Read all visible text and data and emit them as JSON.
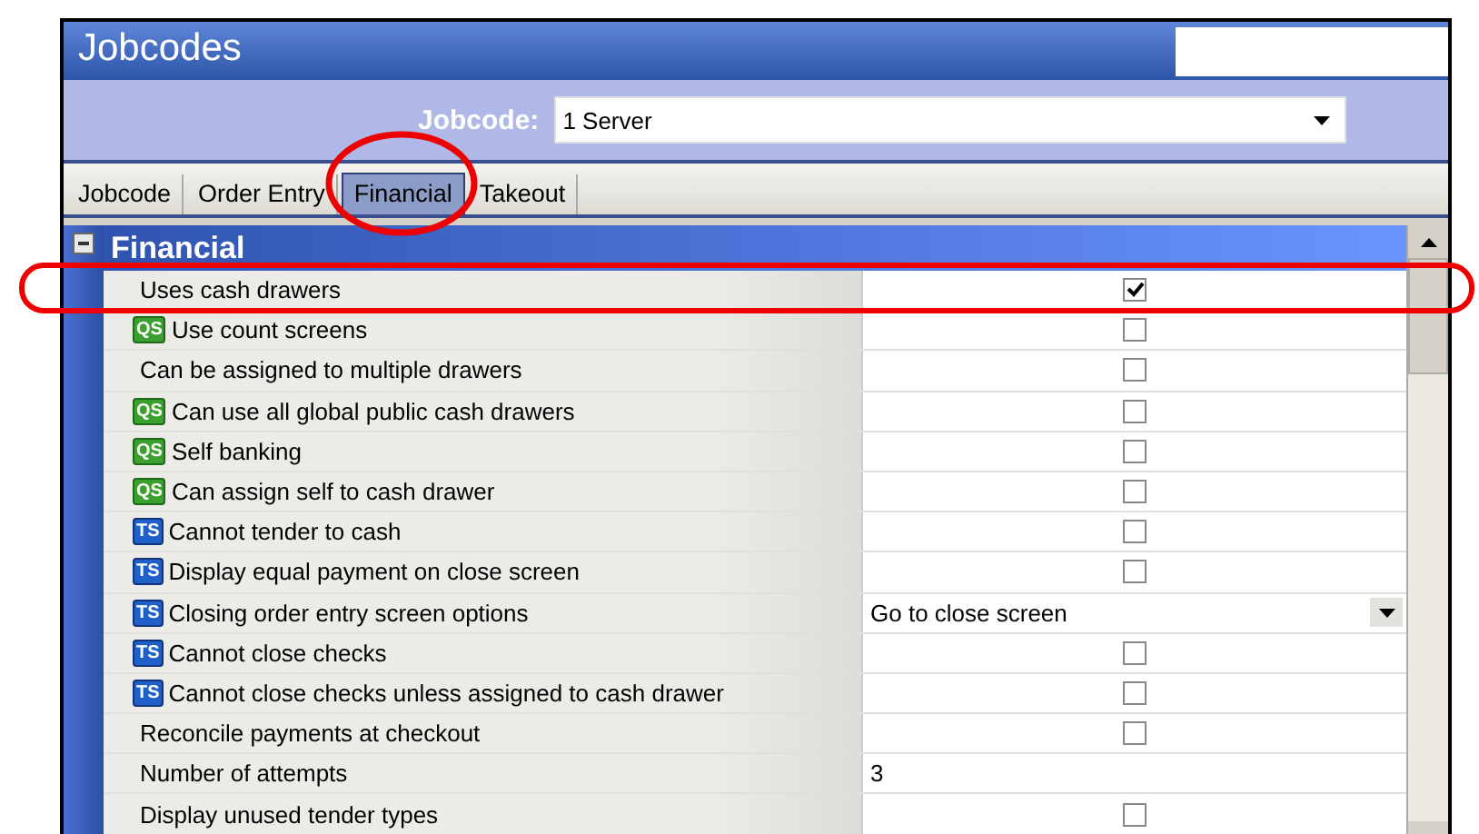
{
  "window": {
    "title": "Jobcodes"
  },
  "jobcode": {
    "label": "Jobcode:",
    "value": "1 Server"
  },
  "tabs": [
    {
      "label": "Jobcode",
      "selected": false
    },
    {
      "label": "Order Entry",
      "selected": false
    },
    {
      "label": "Financial",
      "selected": true
    },
    {
      "label": "Takeout",
      "selected": false
    }
  ],
  "section": {
    "title": "Financial",
    "expanded": true
  },
  "rows": [
    {
      "label": "Uses cash drawers",
      "kind": "checkbox",
      "checked": true
    },
    {
      "label": "Use count screens",
      "badge": "QS",
      "kind": "checkbox",
      "checked": false
    },
    {
      "label": "Can be assigned to multiple drawers",
      "kind": "checkbox",
      "checked": false
    },
    {
      "label": "Can use all global public cash drawers",
      "badge": "QS",
      "kind": "checkbox",
      "checked": false
    },
    {
      "label": "Self banking",
      "badge": "QS",
      "kind": "checkbox",
      "checked": false
    },
    {
      "label": "Can assign self to cash drawer",
      "badge": "QS",
      "kind": "checkbox",
      "checked": false
    },
    {
      "label": "Cannot tender to cash",
      "badge": "TS",
      "kind": "checkbox",
      "checked": false
    },
    {
      "label": "Display equal payment on close screen",
      "badge": "TS",
      "kind": "checkbox",
      "checked": false
    },
    {
      "label": "Closing order entry screen options",
      "badge": "TS",
      "kind": "select",
      "value": "Go to close screen"
    },
    {
      "label": "Cannot close checks",
      "badge": "TS",
      "kind": "checkbox",
      "checked": false
    },
    {
      "label": "Cannot close checks unless assigned to cash drawer",
      "badge": "TS",
      "kind": "checkbox",
      "checked": false
    },
    {
      "label": "Reconcile payments at checkout",
      "kind": "checkbox",
      "checked": false
    },
    {
      "label": "Number of attempts",
      "kind": "text",
      "value": "3"
    },
    {
      "label": "Display unused tender types",
      "kind": "checkbox",
      "checked": false
    }
  ]
}
